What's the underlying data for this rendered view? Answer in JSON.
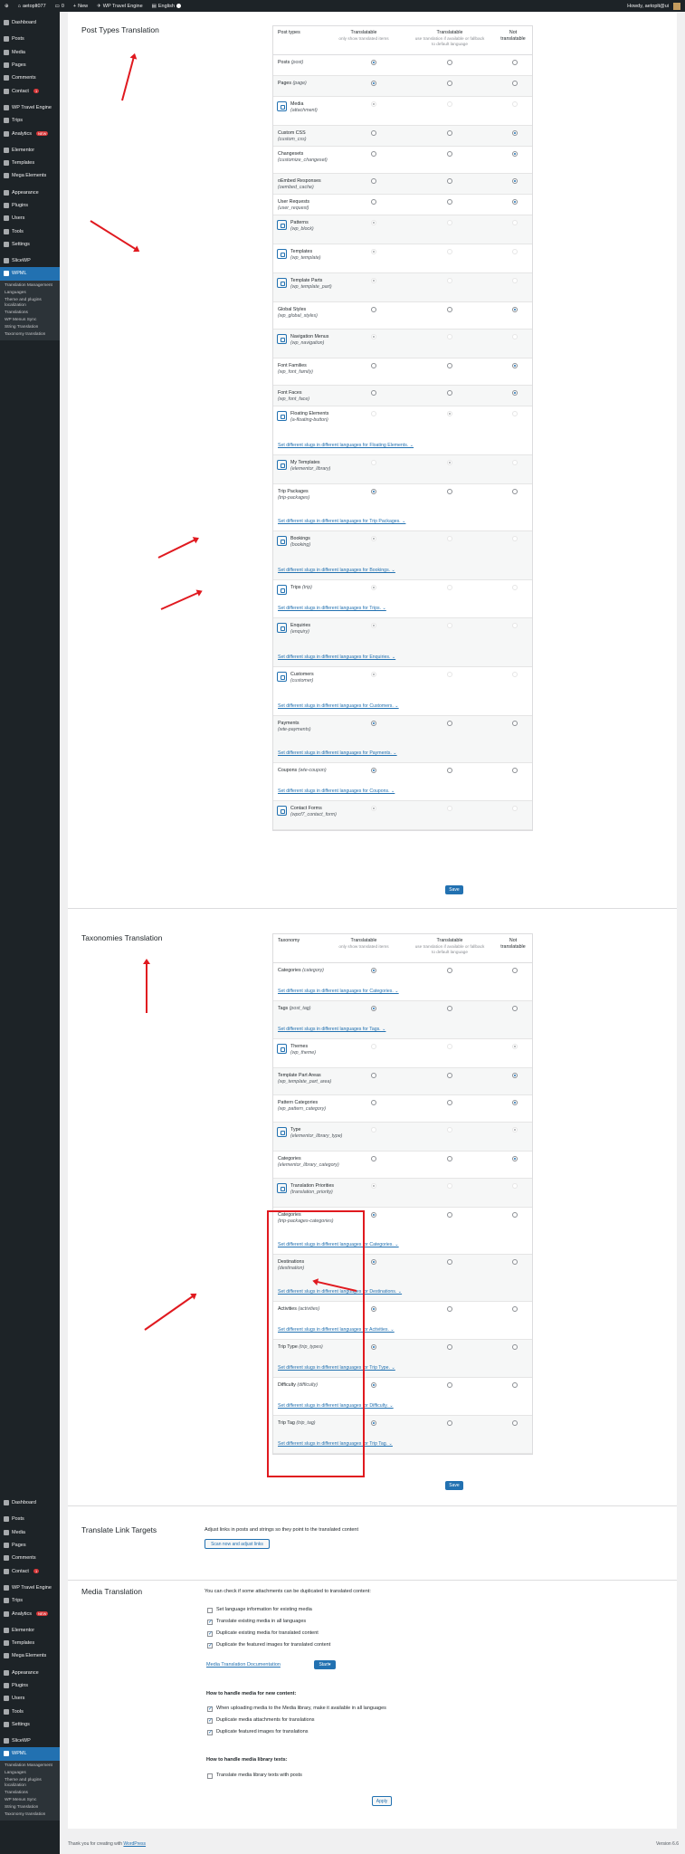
{
  "adminbar": {
    "site": "aetoplt077",
    "comments": "0",
    "new": "New",
    "plugin": "WP Travel Engine",
    "language": "English",
    "greeting": "Howdy, aetoplt@ui"
  },
  "sidebar": {
    "top": [
      {
        "label": "Dashboard"
      },
      {
        "label": "Posts",
        "sep": true
      },
      {
        "label": "Media"
      },
      {
        "label": "Pages"
      },
      {
        "label": "Comments"
      },
      {
        "label": "Contact",
        "badge": "1"
      },
      {
        "label": "WP Travel Engine",
        "sep": true
      },
      {
        "label": "Trips"
      },
      {
        "label": "Analytics",
        "badge": "NEW"
      },
      {
        "label": "Elementor",
        "sep": true
      },
      {
        "label": "Templates"
      },
      {
        "label": "Mega Elements"
      },
      {
        "label": "Appearance",
        "sep": true
      },
      {
        "label": "Plugins"
      },
      {
        "label": "Users"
      },
      {
        "label": "Tools"
      },
      {
        "label": "Settings"
      },
      {
        "label": "SliceWP",
        "sep": true
      },
      {
        "label": "WPML",
        "active": true
      }
    ],
    "wpml_sub_top": [
      "Translation Management",
      "Languages",
      "Theme and plugins localization",
      "Translations",
      "WP Menus Sync",
      "String Translation",
      "Taxonomy translation"
    ],
    "bottom": [
      {
        "label": "Dashboard"
      },
      {
        "label": "Posts",
        "sep": true
      },
      {
        "label": "Media"
      },
      {
        "label": "Pages"
      },
      {
        "label": "Comments"
      },
      {
        "label": "Contact",
        "badge": "1"
      },
      {
        "label": "WP Travel Engine",
        "sep": true
      },
      {
        "label": "Trips"
      },
      {
        "label": "Analytics",
        "badge": "NEW"
      },
      {
        "label": "Elementor",
        "sep": true
      },
      {
        "label": "Templates"
      },
      {
        "label": "Mega Elements"
      },
      {
        "label": "Appearance",
        "sep": true
      },
      {
        "label": "Plugins"
      },
      {
        "label": "Users"
      },
      {
        "label": "Tools"
      },
      {
        "label": "Settings"
      },
      {
        "label": "SliceWP",
        "sep": true
      },
      {
        "label": "WPML",
        "active": true
      }
    ],
    "wpml_sub_bottom": [
      "Translation Management",
      "Languages",
      "Theme and plugins localization",
      "Translations",
      "WP Menus Sync",
      "String Translation",
      "Taxonomy translation"
    ]
  },
  "post_types": {
    "title": "Post Types Translation",
    "headers": {
      "name": "Post types",
      "col1": "Translatable",
      "col1_sub": "only show translated items",
      "col2": "Translatable",
      "col2_sub": "use translation if available or fallback to default language",
      "col3": "Not translatable"
    },
    "rows": [
      {
        "name": "Posts",
        "slug": "(post)",
        "sel": 0
      },
      {
        "name": "Pages",
        "slug": "(page)",
        "sel": 0
      },
      {
        "name": "Media",
        "slug": "(attachment)",
        "sel": 0,
        "locked": true
      },
      {
        "name": "Custom CSS",
        "slug": "(custom_css)",
        "sel": 2
      },
      {
        "name": "Changesets",
        "slug": "(customize_changeset)",
        "sel": 2
      },
      {
        "name": "oEmbed Responses",
        "slug": "(oembed_cache)",
        "sel": 2
      },
      {
        "name": "User Requests",
        "slug": "(user_request)",
        "sel": 2
      },
      {
        "name": "Patterns",
        "slug": "(wp_block)",
        "sel": 0,
        "locked": true
      },
      {
        "name": "Templates",
        "slug": "(wp_template)",
        "sel": 0,
        "locked": true
      },
      {
        "name": "Template Parts",
        "slug": "(wp_template_part)",
        "sel": 0,
        "locked": true
      },
      {
        "name": "Global Styles",
        "slug": "(wp_global_styles)",
        "sel": 2
      },
      {
        "name": "Navigation Menus",
        "slug": "(wp_navigation)",
        "sel": 0,
        "locked": true
      },
      {
        "name": "Font Families",
        "slug": "(wp_font_family)",
        "sel": 2
      },
      {
        "name": "Font Faces",
        "slug": "(wp_font_face)",
        "sel": 2
      },
      {
        "name": "Floating Elements",
        "slug": "(a-floating-button)",
        "sel": 1,
        "locked": true,
        "link": "Set different slugs in different languages for Floating Elements."
      },
      {
        "name": "My Templates",
        "slug": "(elementor_library)",
        "sel": 1,
        "locked": true
      },
      {
        "name": "Trip Packages",
        "slug": "(trip-packages)",
        "sel": 0,
        "link": "Set different slugs in different languages for Trip Packages."
      },
      {
        "name": "Bookings",
        "slug": "(booking)",
        "sel": 0,
        "locked": true,
        "link": "Set different slugs in different languages for Bookings."
      },
      {
        "name": "Trips",
        "slug": "(trip)",
        "sel": 0,
        "locked": true,
        "inline": true,
        "link": "Set different slugs in different languages for Trips."
      },
      {
        "name": "Enquiries",
        "slug": "(enquiry)",
        "sel": 0,
        "locked": true,
        "link": "Set different slugs in different languages for Enquiries."
      },
      {
        "name": "Customers",
        "slug": "(customer)",
        "sel": 0,
        "locked": true,
        "link": "Set different slugs in different languages for Customers."
      },
      {
        "name": "Payments",
        "slug": "(wte-payments)",
        "sel": 0,
        "link": "Set different slugs in different languages for Payments."
      },
      {
        "name": "Coupons",
        "slug": "(wte-coupon)",
        "sel": 0,
        "inline": true,
        "link": "Set different slugs in different languages for Coupons."
      },
      {
        "name": "Contact Forms",
        "slug": "(wpcf7_contact_form)",
        "sel": 0,
        "locked": true
      }
    ],
    "save": "Save"
  },
  "taxonomies": {
    "title": "Taxonomies Translation",
    "headers": {
      "name": "Taxonomy",
      "col1": "Translatable",
      "col1_sub": "only show translated items",
      "col2": "Translatable",
      "col2_sub": "use translation if available or fallback to default language",
      "col3": "Not translatable"
    },
    "rows": [
      {
        "name": "Categories",
        "slug": "(category)",
        "sel": 0,
        "inline": true,
        "link": "Set different slugs in different languages for Categories."
      },
      {
        "name": "Tags",
        "slug": "(post_tag)",
        "sel": 0,
        "inline": true,
        "link": "Set different slugs in different languages for Tags."
      },
      {
        "name": "Themes",
        "slug": "(wp_theme)",
        "sel": 2,
        "locked": true
      },
      {
        "name": "Template Part Areas",
        "slug": "(wp_template_part_area)",
        "sel": 2
      },
      {
        "name": "Pattern Categories",
        "slug": "(wp_pattern_category)",
        "sel": 2
      },
      {
        "name": "Type",
        "slug": "(elementor_library_type)",
        "sel": 2,
        "locked": true
      },
      {
        "name": "Categories",
        "slug": "(elementor_library_category)",
        "sel": 2
      },
      {
        "name": "Translation Priorities",
        "slug": "(translation_priority)",
        "sel": 0,
        "locked": true
      },
      {
        "name": "Categories",
        "slug": "(trip-packages-categories)",
        "sel": 0,
        "link": "Set different slugs in different languages for Categories."
      },
      {
        "name": "Destinations",
        "slug": "(destination)",
        "sel": 0,
        "link": "Set different slugs in different languages for Destinations."
      },
      {
        "name": "Activities",
        "slug": "(activities)",
        "sel": 0,
        "inline": true,
        "link": "Set different slugs in different languages for Activities."
      },
      {
        "name": "Trip Type",
        "slug": "(trip_types)",
        "sel": 0,
        "inline": true,
        "link": "Set different slugs in different languages for Trip Type."
      },
      {
        "name": "Difficulty",
        "slug": "(difficulty)",
        "sel": 0,
        "inline": true,
        "link": "Set different slugs in different languages for Difficulty."
      },
      {
        "name": "Trip Tag",
        "slug": "(trip_tag)",
        "sel": 0,
        "inline": true,
        "link": "Set different slugs in different languages for Trip Tag."
      }
    ],
    "save": "Save"
  },
  "link_targets": {
    "title": "Translate Link Targets",
    "desc": "Adjust links in posts and strings so they point to the translated content",
    "button": "Scan now and adjust links"
  },
  "media": {
    "title": "Media Translation",
    "intro": "You can check if some attachments can be duplicated to translated content:",
    "existing": [
      {
        "label": "Set language information for existing media",
        "checked": false
      },
      {
        "label": "Translate existing media in all languages",
        "checked": true
      },
      {
        "label": "Duplicate existing media for translated content",
        "checked": true
      },
      {
        "label": "Duplicate the featured images for translated content",
        "checked": true
      }
    ],
    "doc_link": "Media Translation Documentation",
    "start": "Start",
    "new_heading": "How to handle media for new content:",
    "new_opts": [
      {
        "label": "When uploading media to the Media library, make it available in all languages",
        "checked": true
      },
      {
        "label": "Duplicate media attachments for translations",
        "checked": true
      },
      {
        "label": "Duplicate featured images for translations",
        "checked": true
      }
    ],
    "texts_heading": "How to handle media library texts:",
    "texts_opts": [
      {
        "label": "Translate media library texts with posts",
        "checked": false
      }
    ],
    "apply": "Apply"
  },
  "footer": {
    "thanks": "Thank you for creating with",
    "wp": "WordPress",
    "version": "Version 6.6"
  }
}
